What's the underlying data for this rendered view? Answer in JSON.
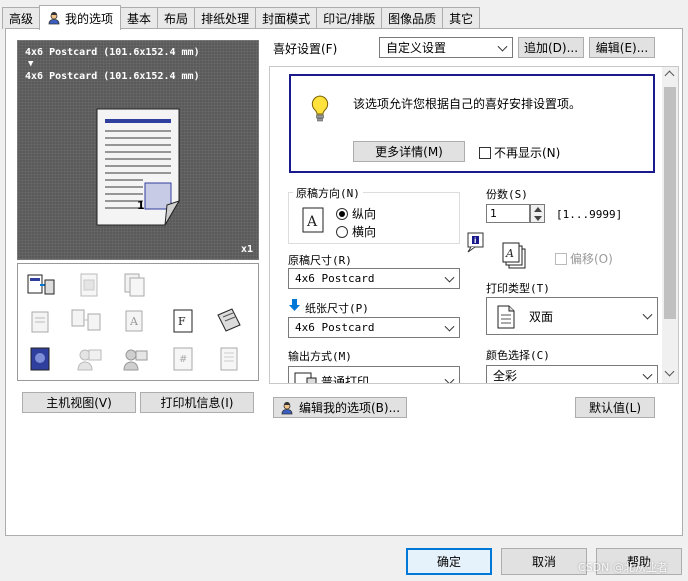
{
  "tabs": [
    {
      "label": "高级"
    },
    {
      "label": "我的选项",
      "active": true,
      "icon": "user-icon"
    },
    {
      "label": "基本"
    },
    {
      "label": "布局"
    },
    {
      "label": "排纸处理"
    },
    {
      "label": "封面模式"
    },
    {
      "label": "印记/排版"
    },
    {
      "label": "图像品质"
    },
    {
      "label": "其它"
    }
  ],
  "preview": {
    "paper_line1": "4x6 Postcard (101.6x152.4 mm)",
    "arrow": "▼",
    "paper_line2": "4x6 Postcard (101.6x152.4 mm)",
    "page_number": "1",
    "copies_badge": "x1"
  },
  "left_buttons": {
    "host_view": "主机视图(V)",
    "printer_info": "打印机信息(I)"
  },
  "favorites": {
    "label": "喜好设置(F)",
    "selected": "自定义设置",
    "add": "追加(D)...",
    "edit": "编辑(E)..."
  },
  "info_box": {
    "message": "该选项允许您根据自己的喜好安排设置项。",
    "more_button": "更多详情(M)",
    "dont_show": "不再显示(N)"
  },
  "orientation": {
    "label": "原稿方向(N)",
    "portrait": "纵向",
    "landscape": "横向",
    "selected": "portrait"
  },
  "original_size": {
    "label": "原稿尺寸(R)",
    "value": "4x6 Postcard"
  },
  "paper_size": {
    "label": "纸张尺寸(P)",
    "value": "4x6 Postcard"
  },
  "output": {
    "label": "输出方式(M)",
    "value": "普通打印"
  },
  "copies": {
    "label": "份数(S)",
    "value": "1",
    "range": "[1...9999]"
  },
  "offset": {
    "label": "偏移(O)"
  },
  "print_type": {
    "label": "打印类型(T)",
    "value": "双面"
  },
  "color": {
    "label": "颜色选择(C)",
    "value": "全彩"
  },
  "bottom": {
    "edit_options": "编辑我的选项(B)...",
    "defaults": "默认值(L)"
  },
  "dialog": {
    "ok": "确定",
    "cancel": "取消",
    "help": "帮助"
  },
  "watermark": "CSDN @北从业者",
  "colors": {
    "accent_blue": "#0078d7",
    "info_border": "#1a1a8c",
    "page_band": "#2f3f9e"
  }
}
